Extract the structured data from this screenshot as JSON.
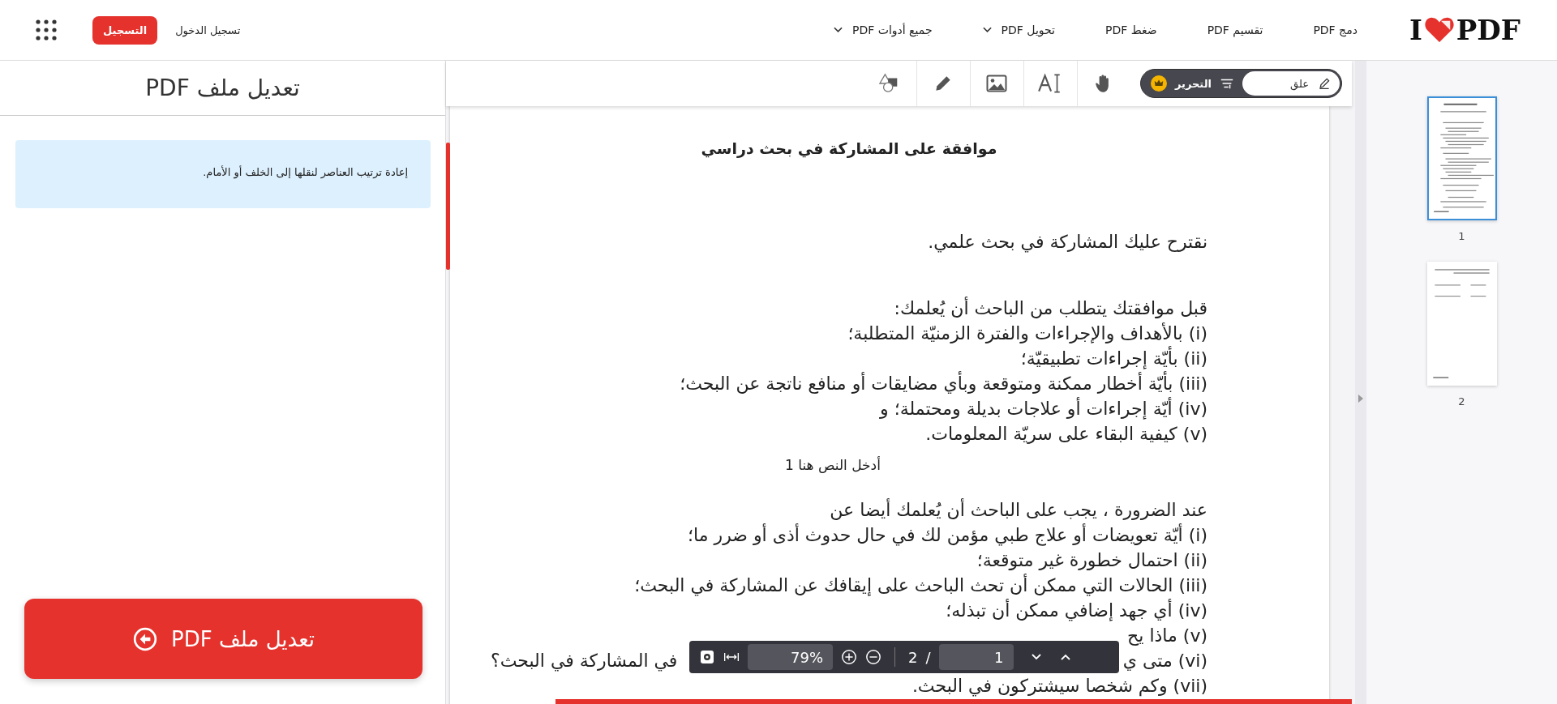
{
  "header": {
    "logo": {
      "left": "I",
      "right": "PDF"
    },
    "nav": [
      {
        "label": "دمج PDF",
        "dropdown": false
      },
      {
        "label": "تقسيم PDF",
        "dropdown": false
      },
      {
        "label": "ضغط PDF",
        "dropdown": false
      },
      {
        "label": "تحويل PDF",
        "dropdown": true
      },
      {
        "label": "جميع أدوات PDF",
        "dropdown": true
      }
    ],
    "login": "تسجيل الدخول",
    "signup": "التسجيل"
  },
  "left_panel": {
    "title": "تعديل ملف PDF",
    "info": "إعادة ترتيب العناصر لنقلها إلى الخلف أو الأمام.",
    "action": "تعديل ملف PDF"
  },
  "toolbar": {
    "modes": [
      {
        "kind": "annotate",
        "label": "علق",
        "selected": true
      },
      {
        "kind": "edit",
        "label": "التحرير",
        "selected": false,
        "premium": true
      }
    ],
    "tools": [
      {
        "kind": "hand"
      },
      {
        "kind": "text"
      },
      {
        "kind": "image"
      },
      {
        "kind": "pencil"
      },
      {
        "kind": "shapes"
      }
    ]
  },
  "document": {
    "title": "موافقة على المشاركة في بحث دراسي",
    "sections": [
      {
        "kind": "paragraph",
        "lines": [
          {
            "kind": "line",
            "text": "نقترح عليك المشاركة في بحث علمي."
          }
        ]
      },
      {
        "kind": "paragraph",
        "lines": [
          {
            "kind": "line",
            "text": "قبل موافقتك يتطلب من الباحث أن يُعلمك:"
          },
          {
            "kind": "line",
            "text": "(i) بالأهداف والإجراءات والفترة الزمنيّة المتطلبة؛"
          },
          {
            "kind": "line",
            "text": "(ii) بأيّة إجراءات تطبيقيّة؛"
          },
          {
            "kind": "line",
            "text": "(iii) بأيّة أخطار ممكنة ومتوقعة وبأي مضايقات أو منافع ناتجة عن البحث؛"
          },
          {
            "kind": "line",
            "text": "(iv) أيّة إجراءات أو علاجات بديلة ومحتملة؛ و"
          },
          {
            "kind": "line",
            "text": "(v) كيفية البقاء على سريّة المعلومات."
          }
        ]
      },
      {
        "kind": "text-box",
        "lines": [
          {
            "kind": "line",
            "text": "أدخل النص هنا 1"
          }
        ]
      },
      {
        "kind": "paragraph",
        "lines": [
          {
            "kind": "line",
            "text": "عند الضرورة ، يجب على الباحث أن يُعلمك أيضا عن"
          },
          {
            "kind": "line",
            "text": "(i) أيّة تعويضات أو علاج طبي مؤمن لك في حال حدوث أذى أو ضرر ما؛"
          },
          {
            "kind": "line",
            "text": "(ii) احتمال خطورة غير متوقعة؛"
          },
          {
            "kind": "line",
            "text": "(iii) الحالات التي ممكن أن تحث الباحث على إيقافك عن المشاركة في البحث؛"
          },
          {
            "kind": "line",
            "text": "(iv) أي جهد إضافي ممكن أن تبذله؛"
          },
          {
            "kind": "split",
            "start": "(v) ماذا يح"
          },
          {
            "kind": "split",
            "start": "(vi) متى ي",
            "end": "في المشاركة في البحث؟"
          },
          {
            "kind": "line",
            "text": "(vii) وكم شخصا سيشتركون في البحث."
          }
        ]
      }
    ]
  },
  "viewer_bar": {
    "zoom": "79%",
    "total_pages": "2",
    "separator": "/",
    "current_page": "1"
  },
  "thumbnails": [
    {
      "number": "1",
      "selected": true,
      "kind": "text-page"
    },
    {
      "number": "2",
      "selected": false,
      "kind": "form-page"
    }
  ]
}
